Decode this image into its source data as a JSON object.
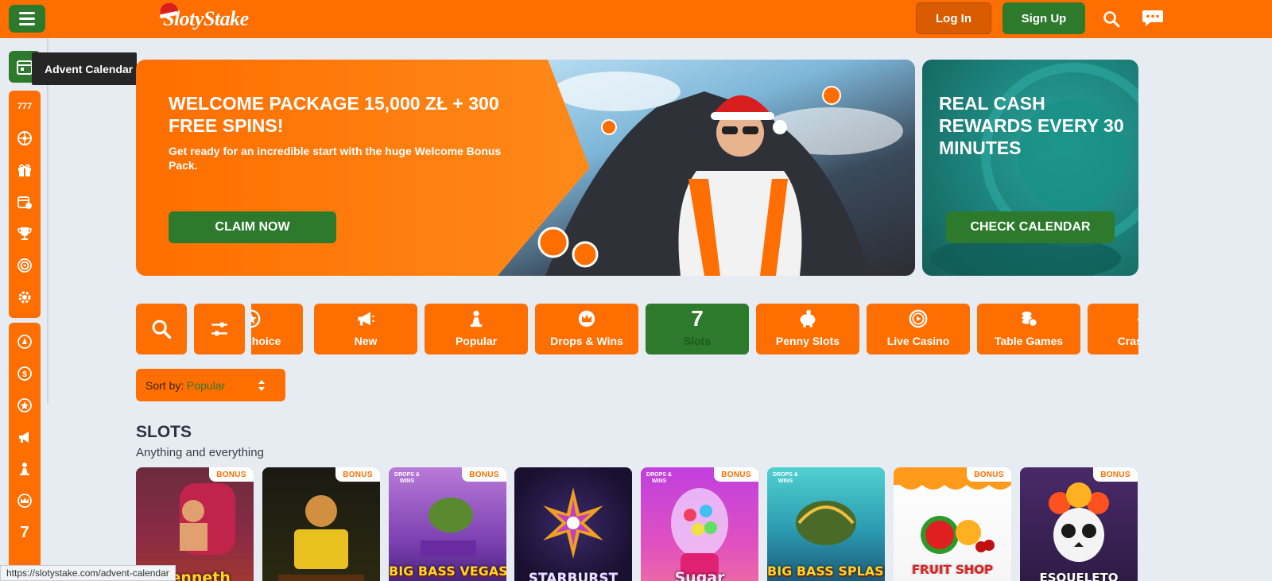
{
  "header": {
    "brand": "SlotyStake",
    "login_label": "Log In",
    "signup_label": "Sign Up",
    "icons": [
      "menu-icon",
      "search-icon",
      "chat-icon"
    ]
  },
  "sidebar": {
    "tooltip": "Advent Calendar",
    "group1_first_label": "777",
    "icons": [
      "calendar-icon",
      "777-icon",
      "wheel-icon",
      "gift-icon",
      "calendar-trophy-icon",
      "trophy-icon",
      "target-icon",
      "gear-icon",
      "bell-icon",
      "coin-icon",
      "star-icon",
      "megaphone-icon",
      "pawn-icon",
      "crown-icon",
      "seven-icon"
    ]
  },
  "banner_main": {
    "title": "WELCOME PACKAGE 15,000 ZŁ + 300 FREE SPINS!",
    "subtitle": "Get ready for an incredible start with the huge Welcome Bonus Pack.",
    "cta": "CLAIM NOW"
  },
  "banner_side": {
    "title": "REAL CASH REWARDS EVERY 30 MINUTES",
    "cta": "CHECK CALENDAR"
  },
  "categories": [
    {
      "label": "Choice",
      "icon": "star-icon"
    },
    {
      "label": "New",
      "icon": "megaphone-icon"
    },
    {
      "label": "Popular",
      "icon": "pawn-icon"
    },
    {
      "label": "Drops & Wins",
      "icon": "crown-icon"
    },
    {
      "label": "Slots",
      "icon": "seven-icon",
      "active": true
    },
    {
      "label": "Penny Slots",
      "icon": "piggy-bank-icon"
    },
    {
      "label": "Live Casino",
      "icon": "play-icon"
    },
    {
      "label": "Table Games",
      "icon": "chips-icon"
    },
    {
      "label": "Crash G",
      "icon": "rocket-icon"
    }
  ],
  "sort": {
    "label": "Sort by:",
    "value": "Popular"
  },
  "section": {
    "title": "SLOTS",
    "subtitle": "Anything and everything"
  },
  "games": [
    {
      "title": "Kenneth",
      "badge": "BONUS",
      "drops": ""
    },
    {
      "title": "",
      "badge": "BONUS",
      "drops": ""
    },
    {
      "title": "BIG BASS VEGAS",
      "badge": "BONUS",
      "drops": "DROPS & WINS"
    },
    {
      "title": "STARBURST",
      "badge": "",
      "drops": ""
    },
    {
      "title": "Sugar",
      "badge": "BONUS",
      "drops": "DROPS & WINS"
    },
    {
      "title": "BIG BASS SPLASH",
      "badge": "",
      "drops": "DROPS & WINS"
    },
    {
      "title": "FRUIT SHOP",
      "badge": "BONUS",
      "drops": ""
    },
    {
      "title": "ESQUELETO",
      "badge": "BONUS",
      "drops": ""
    }
  ],
  "status_url": "https://slotystake.com/advent-calendar",
  "colors": {
    "brand_orange": "#ff6e00",
    "brand_green": "#2d7a2d",
    "page_bg": "#e7ebf2"
  }
}
